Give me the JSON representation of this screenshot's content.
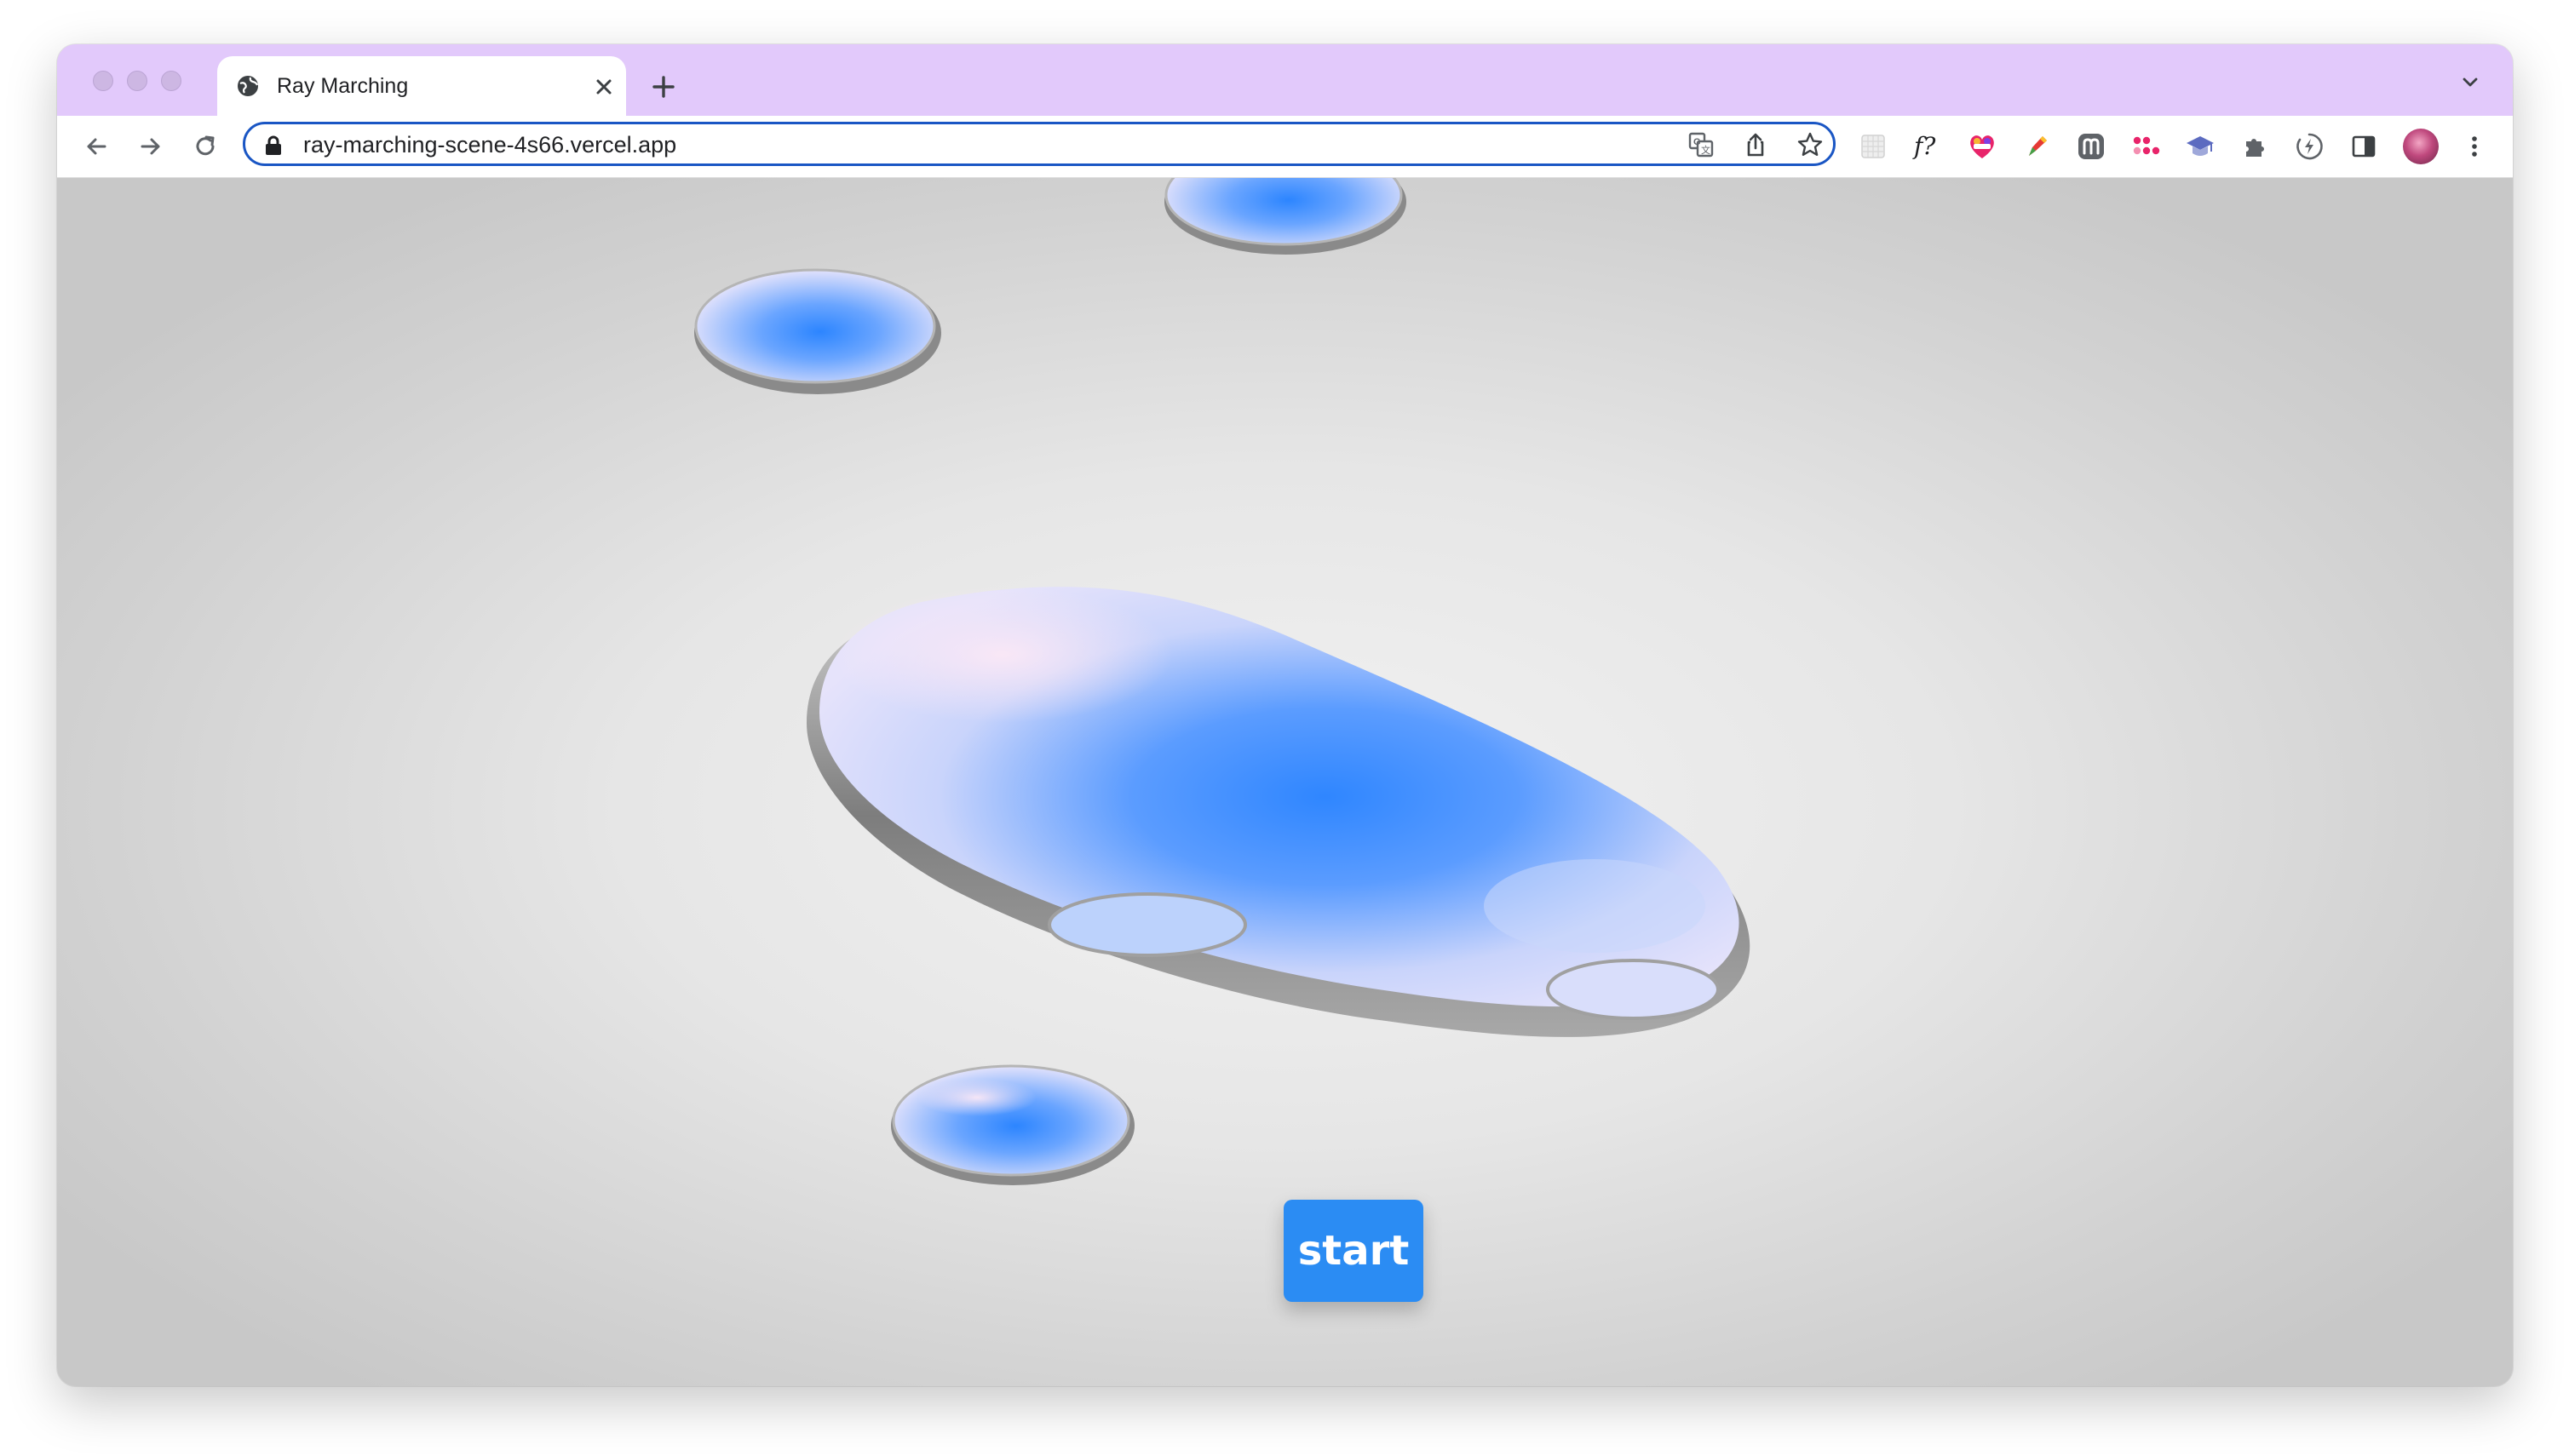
{
  "browser": {
    "tab": {
      "title": "Ray Marching",
      "favicon": "globe-icon"
    },
    "address_bar": {
      "url": "ray-marching-scene-4s66.vercel.app"
    },
    "frame_color": "#e2c9fb",
    "omnibox_border_color": "#1a56c4",
    "extensions": [
      "translate-icon",
      "share-icon",
      "bookmark-star-icon",
      "grid-extension-icon",
      "f-question-extension-icon",
      "heart-extension-icon",
      "pen-extension-icon",
      "m-extension-icon",
      "dots-extension-icon",
      "graduation-cap-icon",
      "puzzle-icon",
      "bolt-icon",
      "side-panel-icon",
      "avatar",
      "more-vert-icon"
    ]
  },
  "page": {
    "start_label": "start",
    "accent_color": "#2b8cf3"
  }
}
